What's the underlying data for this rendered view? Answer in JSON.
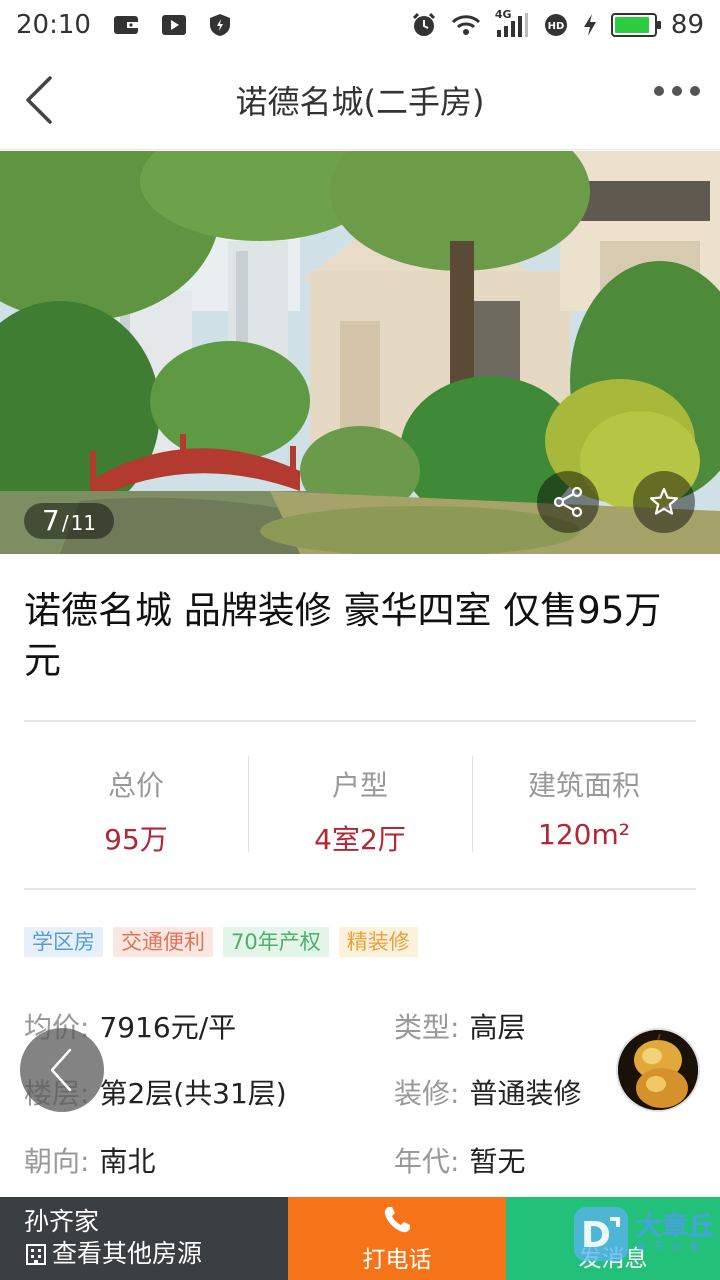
{
  "status_bar": {
    "time": "20:10",
    "network": "4G",
    "battery_level": "89",
    "battery_fraction": 0.89
  },
  "nav": {
    "title": "诺德名城(二手房)"
  },
  "gallery": {
    "current": "7",
    "separator": "/",
    "total": "11"
  },
  "listing": {
    "title": "诺德名城 品牌装修 豪华四室 仅售95万元"
  },
  "stats": [
    {
      "label": "总价",
      "value": "95万"
    },
    {
      "label": "户型",
      "value": "4室2厅"
    },
    {
      "label": "建筑面积",
      "value": "120m²"
    }
  ],
  "tags": [
    {
      "text": "学区房",
      "color": "#5b9bd5",
      "bg": "#e6f0fa"
    },
    {
      "text": "交通便利",
      "color": "#e0735a",
      "bg": "#fbe7e2"
    },
    {
      "text": "70年产权",
      "color": "#4caf6a",
      "bg": "#e2f5e6"
    },
    {
      "text": "精装修",
      "color": "#e8a23a",
      "bg": "#fdf1dc"
    }
  ],
  "details": [
    {
      "key": "均价:",
      "value": "7916元/平"
    },
    {
      "key": "类型:",
      "value": "高层"
    },
    {
      "key": "楼层:",
      "value": "第2层(共31层)"
    },
    {
      "key": "装修:",
      "value": "普通装修"
    },
    {
      "key": "朝向:",
      "value": "南北"
    },
    {
      "key": "年代:",
      "value": "暂无"
    }
  ],
  "bottom_bar": {
    "agent_name": "孙齐家",
    "other_listings": "查看其他房源",
    "call_label": "打电话",
    "message_label": "发消息"
  },
  "watermark": {
    "main": "大章丘",
    "sub": "每天必看",
    "letter": "D"
  },
  "colors": {
    "accent_red": "#b32635",
    "call_orange": "#f57419",
    "message_green": "#23c07a",
    "agent_dark": "#3a3f44",
    "battery_green": "#2ecc40"
  }
}
